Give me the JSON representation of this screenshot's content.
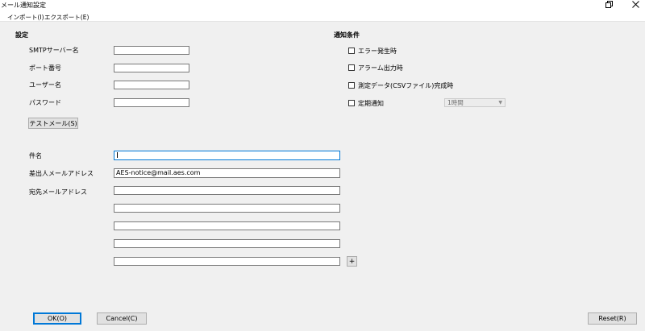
{
  "window": {
    "title": "メール通知設定",
    "icons": {
      "maximize": "restore-icon",
      "close": "close-icon"
    }
  },
  "menu": {
    "import": "インポート(I)",
    "export": "エクスポート(E)"
  },
  "settings": {
    "heading": "設定",
    "smtp_label": "SMTPサーバー名",
    "smtp_value": "",
    "port_label": "ポート番号",
    "port_value": "",
    "user_label": "ユーザー名",
    "user_value": "",
    "password_label": "パスワード",
    "password_value": "",
    "test_mail_button": "テストメール(S)"
  },
  "conditions": {
    "heading": "通知条件",
    "items": [
      {
        "label": "エラー発生時",
        "checked": false
      },
      {
        "label": "アラーム出力時",
        "checked": false
      },
      {
        "label": "測定データ(CSVファイル)完成時",
        "checked": false
      },
      {
        "label": "定期通知",
        "checked": false
      }
    ],
    "interval_value": "1時間"
  },
  "mail": {
    "subject_label": "件名",
    "subject_value": "",
    "sender_label": "差出人メールアドレス",
    "sender_value": "AES-notice@mail.aes.com",
    "recipient_label": "宛先メールアドレス",
    "recipients": [
      "",
      "",
      "",
      "",
      ""
    ],
    "add_button": "+"
  },
  "footer": {
    "ok": "OK(O)",
    "cancel": "Cancel(C)",
    "reset": "Reset(R)"
  },
  "colors": {
    "background": "#f0f0f0",
    "focus_border": "#0078d7"
  }
}
